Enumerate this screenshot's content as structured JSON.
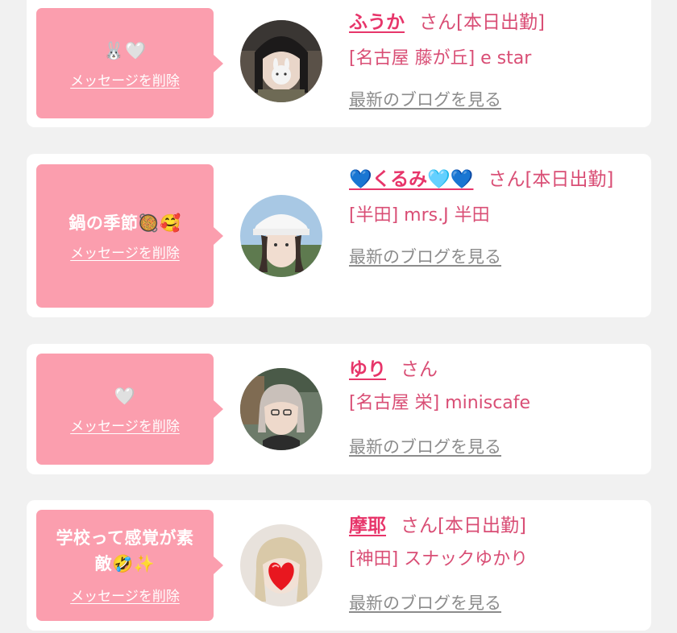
{
  "messages": [
    {
      "message_text": "🐰🤍",
      "delete_label": "メッセージを削除",
      "name": "ふうか",
      "suffix": "さん[本日出勤]",
      "shop": "[名古屋 藤が丘] e star",
      "blog_label": "最新のブログを見る"
    },
    {
      "message_text": "鍋の季節🥘🥰",
      "delete_label": "メッセージを削除",
      "name": "💙くるみ🩵💙",
      "suffix": "さん[本日出勤]",
      "shop": "[半田] mrs.J 半田",
      "blog_label": "最新のブログを見る"
    },
    {
      "message_text": "🤍",
      "delete_label": "メッセージを削除",
      "name": "ゆり",
      "suffix": "さん",
      "shop": "[名古屋 栄] miniscafe",
      "blog_label": "最新のブログを見る"
    },
    {
      "message_text": "学校って感覚が素敵🤣✨",
      "delete_label": "メッセージを削除",
      "name": "摩耶",
      "suffix": "さん[本日出勤]",
      "shop": "[神田] スナックゆかり",
      "blog_label": "最新のブログを見る"
    }
  ],
  "colors": {
    "bubble": "#fb9eae",
    "name": "#e7356a",
    "text": "#d94e75",
    "link_gray": "#8c8c8c",
    "background": "#f1f1f1"
  }
}
